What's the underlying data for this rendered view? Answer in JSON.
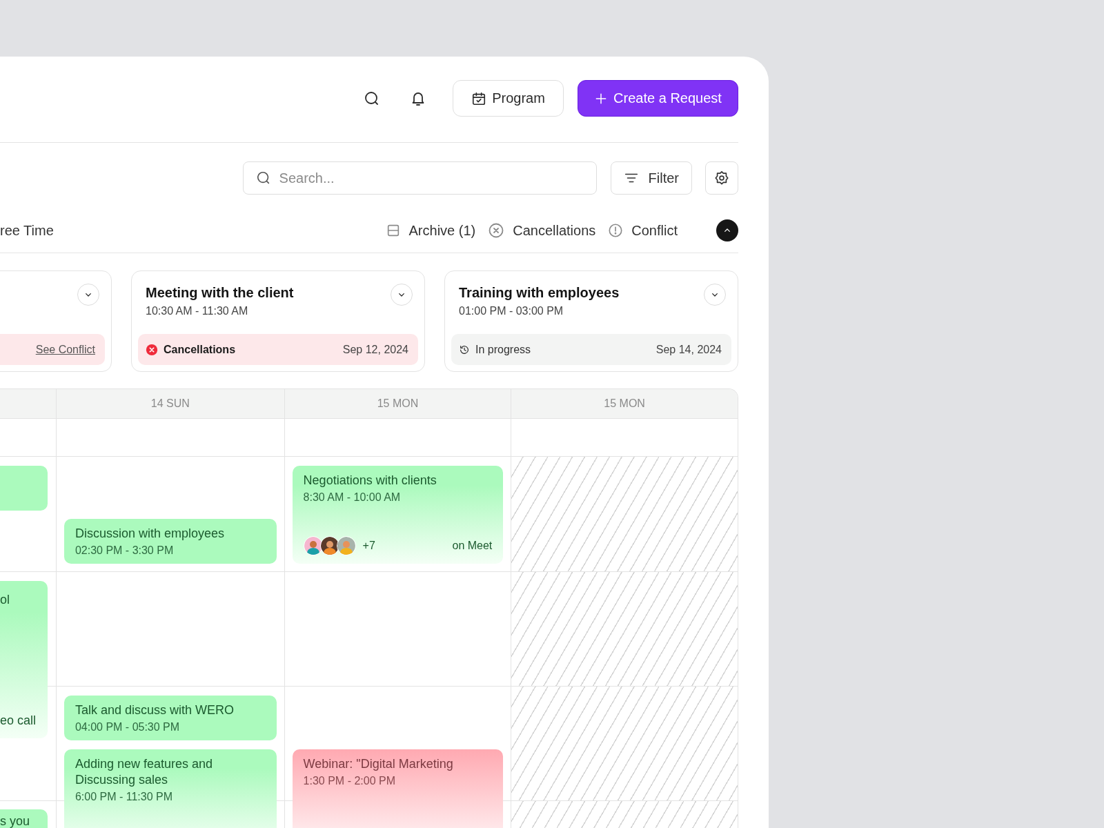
{
  "header": {
    "buttons": [
      {
        "kind": "outline",
        "label": "Program"
      },
      {
        "kind": "primary",
        "label": "Create a Request"
      }
    ]
  },
  "toolbar": {
    "search": {
      "placeholder": "Search..."
    },
    "filter_button": "Filter"
  },
  "tabs": {
    "leading": "ree Time",
    "filters": [
      {
        "kind": "archive",
        "label": "Archive (1)"
      },
      {
        "kind": "cancellations",
        "label": "Cancellations"
      },
      {
        "kind": "conflict",
        "label": "Conflict"
      }
    ],
    "expanded": true
  },
  "cards": [
    {
      "kind": "conflict",
      "link": "See Conflict"
    },
    {
      "title": "Meeting with the client",
      "time": "10:30 AM - 11:30 AM",
      "kind": "cancelled",
      "status_label": "Cancellations",
      "date": "Sep 12, 2024"
    },
    {
      "title": "Training with employees",
      "time": "01:00 PM - 03:00 PM",
      "kind": "in_progress",
      "status_label": "In progress",
      "date": "Sep 14, 2024"
    }
  ],
  "calendar": {
    "columns": [
      {
        "unavailable": false,
        "events": [
          {
            "kind": "scheduled",
            "faded": false
          },
          {
            "title": "ol",
            "note": "eo call",
            "kind": "scheduled",
            "faded": true
          },
          {
            "title": "s you",
            "kind": "scheduled",
            "faded": false
          }
        ]
      },
      {
        "heading": "14 SUN",
        "unavailable": false,
        "events": [
          {
            "title": "Discussion with employees",
            "time": "02:30 PM - 3:30 PM",
            "kind": "scheduled",
            "faded": false
          },
          {
            "title": "Talk and discuss with WERO",
            "time": "04:00 PM - 05:30 PM",
            "kind": "scheduled",
            "faded": false
          },
          {
            "title": "Adding new features and Discussing sales",
            "time": "6:00 PM - 11:30 PM",
            "kind": "scheduled",
            "faded": true
          }
        ]
      },
      {
        "heading": "15 MON",
        "unavailable": false,
        "events": [
          {
            "title": "Negotiations with clients",
            "time": "8:30 AM - 10:00 AM",
            "kind": "scheduled",
            "faded": true,
            "attendees": {
              "more": "+7",
              "place": "on Meet"
            }
          },
          {
            "title": "Webinar: \"Digital Marketing",
            "time": "1:30 PM - 2:00 PM",
            "kind": "cancelled",
            "faded": true
          }
        ]
      },
      {
        "heading": "15 MON",
        "unavailable": true
      }
    ]
  }
}
